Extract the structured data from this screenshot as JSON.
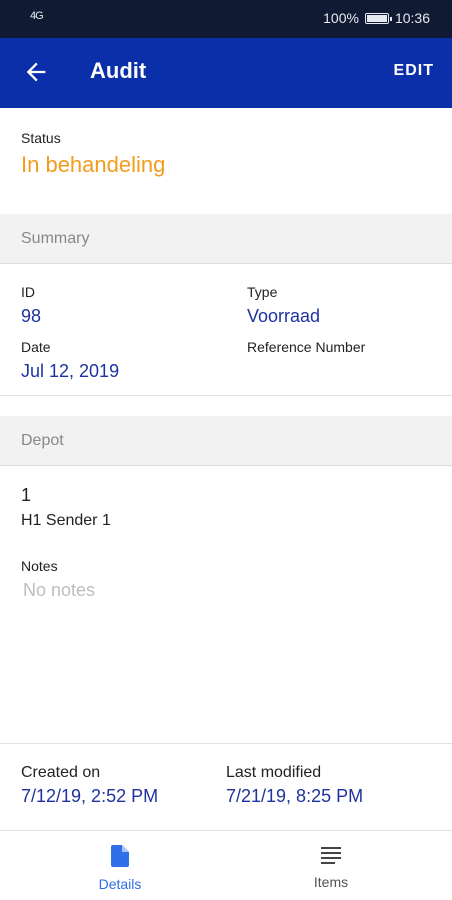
{
  "status_bar": {
    "signal": "4G",
    "battery": "100%",
    "battery_level": 1.0,
    "time": "10:36"
  },
  "app_bar": {
    "back_icon": "arrow-left-icon",
    "title": "Audit",
    "edit_label": "EDIT"
  },
  "status": {
    "label": "Status",
    "value": "In behandeling",
    "color": "#f39c1c"
  },
  "summary": {
    "header": "Summary",
    "id_label": "ID",
    "id_value": "98",
    "type_label": "Type",
    "type_value": "Voorraad",
    "date_label": "Date",
    "date_value": "Jul 12, 2019",
    "reference_label": "Reference Number",
    "reference_value": ""
  },
  "depot": {
    "header": "Depot",
    "number": "1",
    "name": "H1 Sender 1",
    "notes_label": "Notes",
    "notes_value": "No notes"
  },
  "meta": {
    "created_label": "Created on",
    "created_value": "7/12/19, 2:52 PM",
    "modified_label": "Last modified",
    "modified_value": "7/21/19, 8:25 PM"
  },
  "bottom_nav": {
    "active_color": "#2f6fe8",
    "inactive_color": "#555555",
    "items": [
      {
        "label": "Details",
        "icon": "document-icon",
        "active": true
      },
      {
        "label": "Items",
        "icon": "list-icon",
        "active": false
      }
    ]
  },
  "theme": {
    "primary": "#0a2fa8",
    "status_bar": "#101a33",
    "value_text": "#1e33a0"
  }
}
